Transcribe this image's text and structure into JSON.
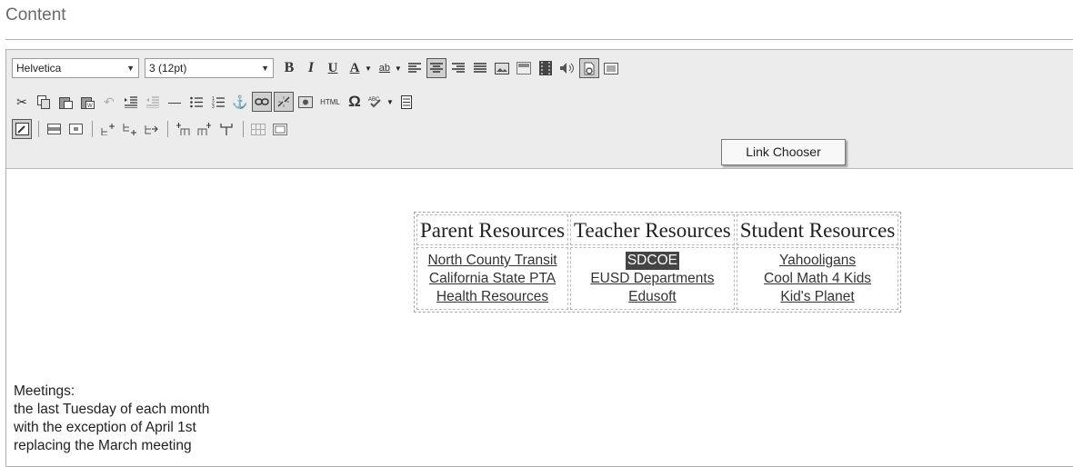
{
  "section": {
    "title": "Content"
  },
  "toolbar": {
    "font_family": "Helvetica",
    "font_size": "3 (12pt)",
    "bold": "B",
    "italic": "I",
    "underline": "U",
    "font_color": "A",
    "highlight": "ab",
    "html_label": "HTML",
    "omega": "Ω"
  },
  "tooltip": {
    "text": "Link Chooser"
  },
  "resources": {
    "headers": [
      "Parent Resources",
      "Teacher Resources",
      "Student Resources"
    ],
    "columns": [
      [
        "North County Transit",
        "California State PTA",
        "Health Resources"
      ],
      [
        "SDCOE",
        "EUSD Departments",
        "Edusoft"
      ],
      [
        "Yahooligans",
        "Cool Math 4 Kids",
        "Kid's Planet"
      ]
    ]
  },
  "meetings": {
    "lines": [
      "Meetings:",
      "the last Tuesday of each month",
      "with the exception of April 1st",
      "replacing the March meeting"
    ]
  }
}
